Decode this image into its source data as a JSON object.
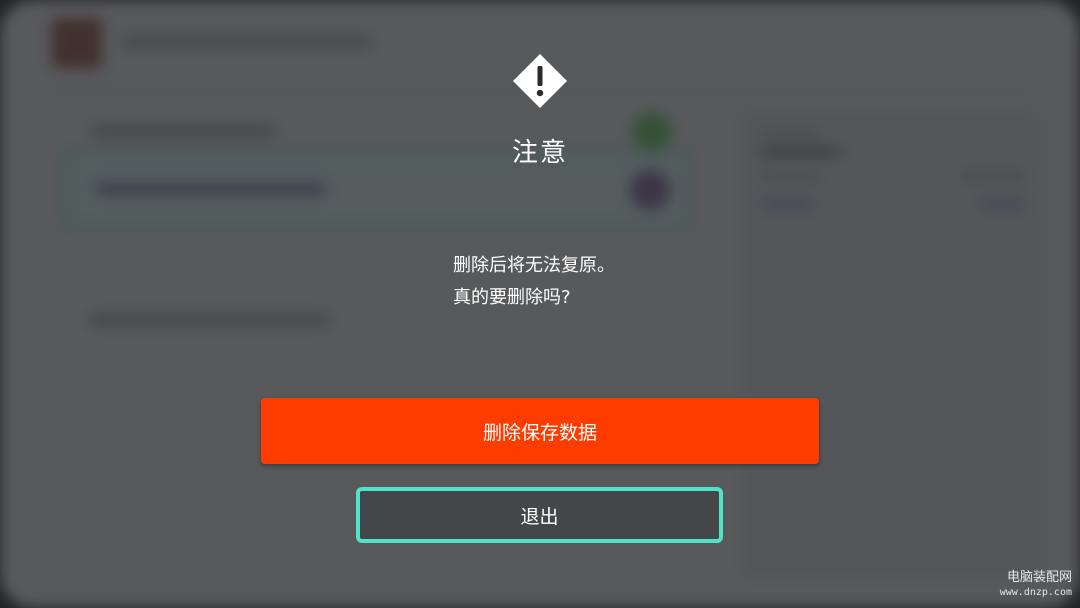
{
  "dialog": {
    "title": "注意",
    "message_lines": [
      "删除后将无法复原。",
      "真的要删除吗?"
    ],
    "confirm_label": "删除保存数据",
    "cancel_label": "退出",
    "icon": "warning-icon"
  },
  "watermark": {
    "name": "电脑装配网",
    "url": "www.dnzp.com"
  },
  "colors": {
    "confirm": "#ff3c00",
    "focus_outline": "#4fe3c9",
    "overlay": "#26272a"
  }
}
